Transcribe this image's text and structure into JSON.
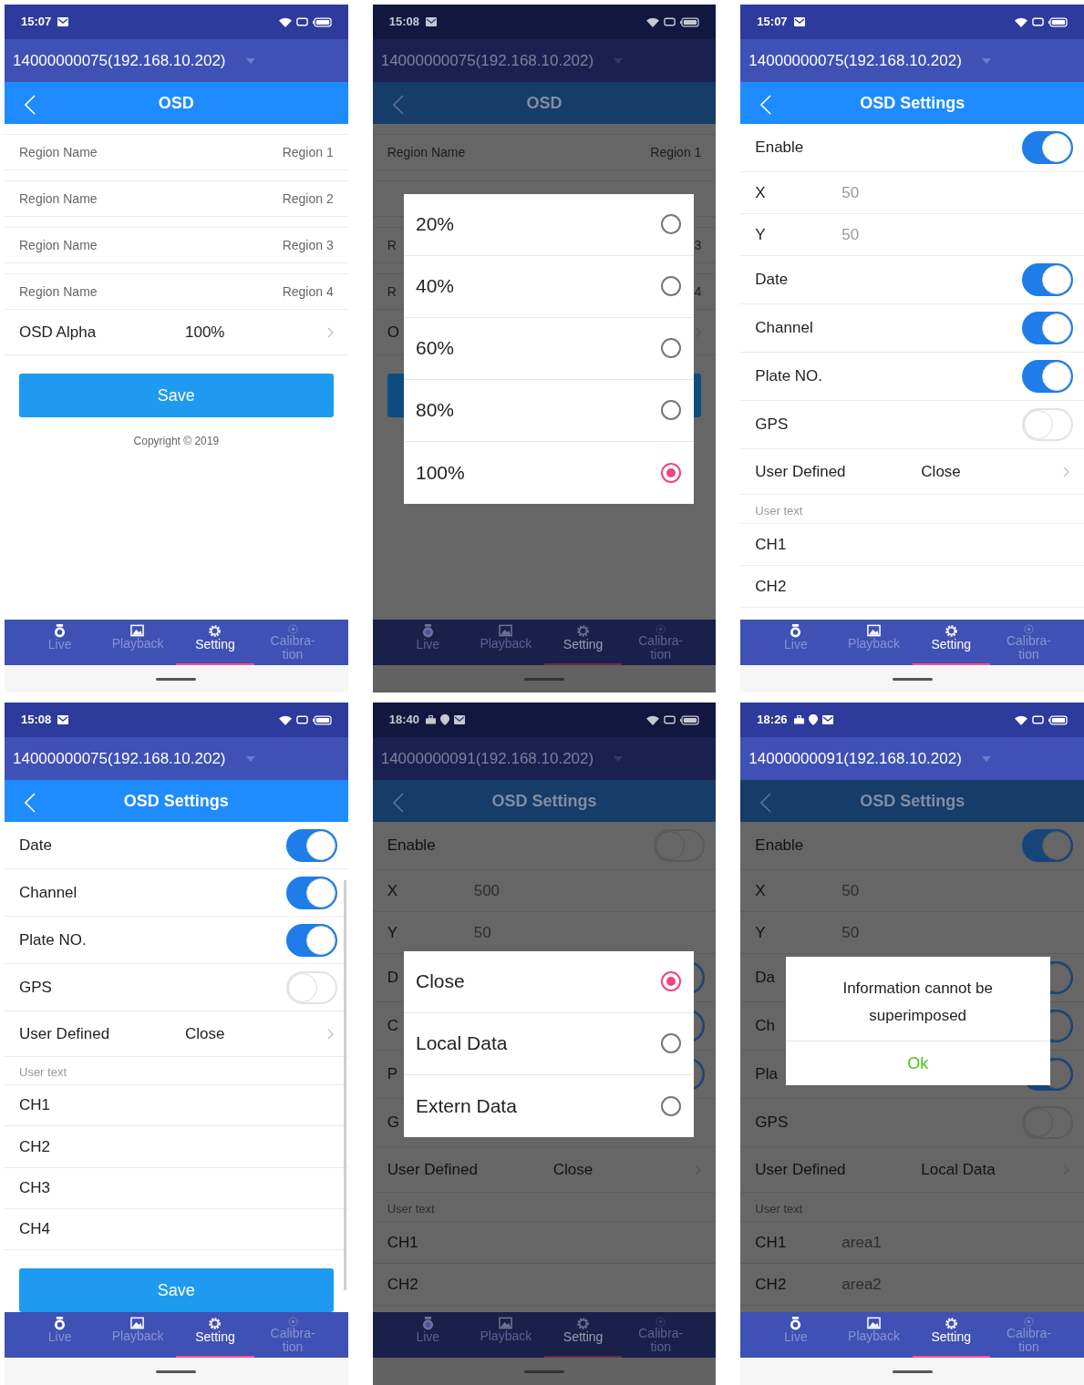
{
  "screens": [
    {
      "status": {
        "time": "15:07",
        "work_icons": false
      },
      "device": "14000000075(192.168.10.202)",
      "title": "OSD",
      "rows": [
        {
          "kind": "region",
          "label": "Region Name",
          "value": "Region 1"
        },
        {
          "kind": "region",
          "label": "Region Name",
          "value": "Region 2"
        },
        {
          "kind": "region",
          "label": "Region Name",
          "value": "Region 3"
        },
        {
          "kind": "region",
          "label": "Region Name",
          "value": "Region 4"
        },
        {
          "kind": "arrow",
          "label": "OSD Alpha",
          "value": "100%"
        },
        {
          "kind": "button",
          "label": "Save"
        },
        {
          "kind": "note",
          "label": "Copyright © 2019"
        }
      ],
      "nav": [
        {
          "label": "Live",
          "selected": false
        },
        {
          "label": "Playback",
          "selected": false
        },
        {
          "label": "Setting",
          "selected": true
        },
        {
          "label": "Calibra-tion",
          "selected": false
        }
      ]
    },
    {
      "status": {
        "time": "15:08",
        "work_icons": false
      },
      "device": "14000000075(192.168.10.202)",
      "title": "OSD",
      "rows": [
        {
          "kind": "region",
          "label": "Region Name",
          "value": "Region 1"
        },
        {
          "kind": "region"
        },
        {
          "kind": "region",
          "label": "R",
          "value": "3"
        },
        {
          "kind": "region",
          "label": "R",
          "value": "4"
        },
        {
          "kind": "arrow",
          "label": "O"
        },
        {
          "kind": "button"
        }
      ],
      "dialog": {
        "kind": "choice",
        "options": [
          {
            "label": "20%",
            "selected": false
          },
          {
            "label": "40%",
            "selected": false
          },
          {
            "label": "60%",
            "selected": false
          },
          {
            "label": "80%",
            "selected": false
          },
          {
            "label": "100%",
            "selected": true
          }
        ]
      },
      "nav": [
        {
          "label": "Live",
          "selected": false
        },
        {
          "label": "Playback",
          "selected": false
        },
        {
          "label": "Setting",
          "selected": true
        },
        {
          "label": "Calibra-tion",
          "selected": false
        }
      ]
    },
    {
      "status": {
        "time": "15:07",
        "work_icons": false
      },
      "device": "14000000075(192.168.10.202)",
      "title": "OSD Settings",
      "rows": [
        {
          "kind": "toggle",
          "label": "Enable",
          "on": true
        },
        {
          "kind": "value",
          "label": "X",
          "value": "50"
        },
        {
          "kind": "value",
          "label": "Y",
          "value": "50"
        },
        {
          "kind": "toggle",
          "label": "Date",
          "on": true
        },
        {
          "kind": "toggle",
          "label": "Channel",
          "on": true
        },
        {
          "kind": "toggle",
          "label": "Plate NO.",
          "on": true
        },
        {
          "kind": "toggle",
          "label": "GPS",
          "on": false
        },
        {
          "kind": "arrow",
          "label": "User Defined",
          "value": "Close"
        },
        {
          "kind": "section",
          "label": "User text"
        },
        {
          "kind": "plain",
          "label": "CH1"
        },
        {
          "kind": "plain",
          "label": "CH2"
        }
      ],
      "nav": [
        {
          "label": "Live",
          "selected": false
        },
        {
          "label": "Playback",
          "selected": false
        },
        {
          "label": "Setting",
          "selected": true
        },
        {
          "label": "Calibra-tion",
          "selected": false
        }
      ]
    },
    {
      "status": {
        "time": "15:08",
        "work_icons": false
      },
      "device": "14000000075(192.168.10.202)",
      "title": "OSD Settings",
      "scrollbar": true,
      "rows": [
        {
          "kind": "toggle",
          "label": "Date",
          "on": true
        },
        {
          "kind": "toggle",
          "label": "Channel",
          "on": true
        },
        {
          "kind": "toggle",
          "label": "Plate NO.",
          "on": true
        },
        {
          "kind": "toggle",
          "label": "GPS",
          "on": false
        },
        {
          "kind": "arrow",
          "label": "User Defined",
          "value": "Close"
        },
        {
          "kind": "section",
          "label": "User text"
        },
        {
          "kind": "plain",
          "label": "CH1"
        },
        {
          "kind": "plain",
          "label": "CH2"
        },
        {
          "kind": "plain",
          "label": "CH3"
        },
        {
          "kind": "plain",
          "label": "CH4"
        },
        {
          "kind": "button",
          "label": "Save"
        }
      ],
      "nav": [
        {
          "label": "Live",
          "selected": false
        },
        {
          "label": "Playback",
          "selected": false
        },
        {
          "label": "Setting",
          "selected": true
        },
        {
          "label": "Calibra-tion",
          "selected": false
        }
      ]
    },
    {
      "status": {
        "time": "18:40",
        "work_icons": true
      },
      "device": "14000000091(192.168.10.202)",
      "title": "OSD Settings",
      "rows": [
        {
          "kind": "toggle",
          "label": "Enable",
          "on": false
        },
        {
          "kind": "value",
          "label": "X",
          "value": "500"
        },
        {
          "kind": "value",
          "label": "Y",
          "value": "50"
        },
        {
          "kind": "toggle",
          "label": "D",
          "on": true
        },
        {
          "kind": "toggle",
          "label": "C",
          "on": true
        },
        {
          "kind": "toggle",
          "label": "P",
          "on": true
        },
        {
          "kind": "toggle",
          "label": "G"
        },
        {
          "kind": "arrow",
          "label": "User Defined",
          "value": "Close"
        },
        {
          "kind": "section",
          "label": "User text"
        },
        {
          "kind": "plain",
          "label": "CH1"
        },
        {
          "kind": "plain",
          "label": "CH2"
        }
      ],
      "dialog": {
        "kind": "choice",
        "options": [
          {
            "label": "Close",
            "selected": true
          },
          {
            "label": "Local Data",
            "selected": false
          },
          {
            "label": "Extern Data",
            "selected": false
          }
        ]
      },
      "nav": [
        {
          "label": "Live",
          "selected": false
        },
        {
          "label": "Playback",
          "selected": false
        },
        {
          "label": "Setting",
          "selected": true
        },
        {
          "label": "Calibra-tion",
          "selected": false
        }
      ]
    },
    {
      "status": {
        "time": "18:26",
        "work_icons": true
      },
      "device": "14000000091(192.168.10.202)",
      "title": "OSD Settings",
      "rows": [
        {
          "kind": "toggle",
          "label": "Enable",
          "on": true
        },
        {
          "kind": "value",
          "label": "X",
          "value": "50"
        },
        {
          "kind": "value",
          "label": "Y",
          "value": "50"
        },
        {
          "kind": "toggle",
          "label": "Da",
          "on": true
        },
        {
          "kind": "toggle",
          "label": "Ch",
          "on": true
        },
        {
          "kind": "toggle",
          "label": "Pla",
          "on": true
        },
        {
          "kind": "toggle",
          "label": "GPS",
          "on": false
        },
        {
          "kind": "arrow",
          "label": "User Defined",
          "value": "Local Data"
        },
        {
          "kind": "section",
          "label": "User text"
        },
        {
          "kind": "value",
          "label": "CH1",
          "value": "area1"
        },
        {
          "kind": "value",
          "label": "CH2",
          "value": "area2"
        }
      ],
      "dialog": {
        "kind": "alert",
        "message": "Information cannot be superimposed",
        "button": "Ok"
      },
      "nav": [
        {
          "label": "Live",
          "selected": false
        },
        {
          "label": "Playback",
          "selected": false
        },
        {
          "label": "Setting",
          "selected": true
        },
        {
          "label": "Calibra-tion",
          "selected": false
        }
      ]
    }
  ]
}
